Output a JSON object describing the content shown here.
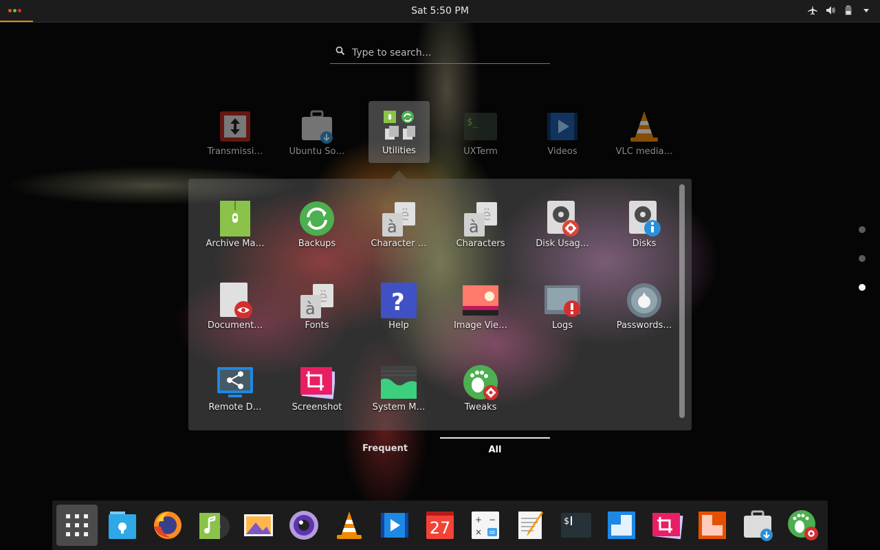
{
  "topbar": {
    "clock": "Sat  5:50 PM",
    "dot_colors": [
      "#e05a2a",
      "#67c23a",
      "#e02a2a"
    ]
  },
  "search": {
    "placeholder": "Type to search…"
  },
  "top_row": [
    {
      "label": "Transmissi…",
      "icon": "transmission-icon"
    },
    {
      "label": "Ubuntu So…",
      "icon": "software-center-icon"
    },
    {
      "label": "Utilities",
      "icon": "utilities-folder-icon"
    },
    {
      "label": "UXTerm",
      "icon": "terminal-icon"
    },
    {
      "label": "Videos",
      "icon": "videos-icon"
    },
    {
      "label": "VLC media…",
      "icon": "vlc-icon"
    }
  ],
  "folder": {
    "name": "Utilities",
    "apps": [
      {
        "label": "Archive Ma…",
        "icon": "archive-manager-icon"
      },
      {
        "label": "Backups",
        "icon": "backups-icon"
      },
      {
        "label": "Character …",
        "icon": "character-map-icon"
      },
      {
        "label": "Characters",
        "icon": "characters-icon"
      },
      {
        "label": "Disk Usag…",
        "icon": "disk-usage-icon"
      },
      {
        "label": "Disks",
        "icon": "disks-icon"
      },
      {
        "label": "Document…",
        "icon": "document-viewer-icon"
      },
      {
        "label": "Fonts",
        "icon": "fonts-icon"
      },
      {
        "label": "Help",
        "icon": "help-icon"
      },
      {
        "label": "Image Vie…",
        "icon": "image-viewer-icon"
      },
      {
        "label": "Logs",
        "icon": "logs-icon"
      },
      {
        "label": "Passwords…",
        "icon": "passwords-icon"
      },
      {
        "label": "Remote D…",
        "icon": "remote-desktop-icon"
      },
      {
        "label": "Screenshot",
        "icon": "screenshot-icon"
      },
      {
        "label": "System M…",
        "icon": "system-monitor-icon"
      },
      {
        "label": "Tweaks",
        "icon": "tweaks-icon"
      }
    ]
  },
  "tabs": {
    "frequent": "Frequent",
    "all": "All",
    "active": "All"
  },
  "pager": {
    "pages": 3,
    "active": 3
  },
  "dock": {
    "items": [
      "show-apps-icon",
      "file-manager-icon",
      "firefox-icon",
      "music-player-icon",
      "image-viewer-icon",
      "camera-icon",
      "vlc-icon",
      "videos-icon",
      "calendar-icon",
      "calculator-icon",
      "text-editor-icon",
      "terminal-icon",
      "window-icon",
      "screenshot-icon",
      "presentation-icon",
      "software-center-icon",
      "tweaks-icon"
    ],
    "calendar_day": "27",
    "terminal_text": "$"
  },
  "icon_text": {
    "uxterm": "$_",
    "help": "?",
    "char_a": "à",
    "char_e": "ë",
    "calc_plus": "+",
    "calc_minus": "−",
    "calc_times": "×",
    "calc_eq": "="
  }
}
